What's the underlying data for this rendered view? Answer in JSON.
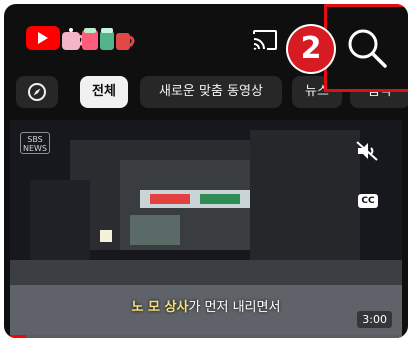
{
  "header": {
    "logo_icon": "youtube-logo-icon",
    "doodle_icon": "coffee-cups-doodle",
    "cast_icon": "cast-icon",
    "search_icon": "search-icon",
    "step_badge": "2",
    "highlight_color": "#e10f14"
  },
  "chips": [
    {
      "label": "",
      "icon": "compass-icon"
    },
    {
      "label": "전체"
    },
    {
      "label": "새로운 맞춤 동영상"
    },
    {
      "label": "뉴스"
    },
    {
      "label": "음악"
    }
  ],
  "video": {
    "channel_logo": "SBS NEWS",
    "subtitle_highlight": "노 모 상사",
    "subtitle_rest": "가 먼저 내리면서",
    "duration": "3:00",
    "mute_icon": "muted-speaker-icon",
    "cc_label": "CC",
    "progress": 0.04
  },
  "colors": {
    "background": "#0f0f0f",
    "chip_bg": "#272727",
    "chip_selected_bg": "#f1f1f1",
    "brand_red": "#ff0000"
  }
}
